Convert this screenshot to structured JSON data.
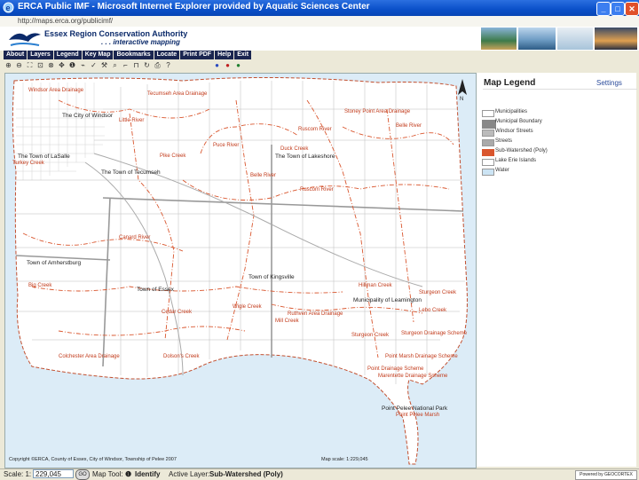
{
  "window": {
    "title": "ERCA Public IMF - Microsoft Internet Explorer provided by Aquatic Sciences Center",
    "address": "http://maps.erca.org/publicimf/"
  },
  "header": {
    "org_name": "Essex Region Conservation Authority",
    "tagline": ". . . interactive mapping"
  },
  "menu": [
    "About",
    "Layers",
    "Legend",
    "Key Map",
    "Bookmarks",
    "Locate",
    "Print PDF",
    "Help",
    "Exit"
  ],
  "map": {
    "copyright": "Copyright ©ERCA, County of Essex, City of Windsor, Township of Pelee 2007",
    "scale_readout": "Map scale: 1:229,045",
    "labels": {
      "windsor_drainage": "Windsor Area Drainage",
      "tecumseh_drainage": "Tecumseh Area Drainage",
      "city_windsor": "The City of Windsor",
      "little_river": "Little River",
      "stoney_point": "Stoney Point Area Drainage",
      "belle_river": "Belle River",
      "puce_river": "Puce River",
      "duck_creek": "Duck Creek",
      "ruscom": "Ruscom River",
      "lakeshore": "The Town of Lakeshore",
      "lasalle": "The Town of LaSalle",
      "turkey_creek": "Turkey Creek",
      "pike_creek": "Pike Creek",
      "tecumseh": "The Town of Tecumseh",
      "belle_river2": "Belle River",
      "canard": "Canard River",
      "amherstburg": "Town of Amherstburg",
      "big_creek": "Big Creek",
      "kingsville": "Town of Kingsville",
      "essex": "Town of Essex",
      "hillman": "Hillman Creek",
      "sturgeon": "Sturgeon Creek",
      "cedar_creek": "Cedar Creek",
      "leamington": "Municipality of Leamington",
      "wigle": "Wigle Creek",
      "mill_creek": "Mill Creek",
      "ruthven": "Ruthven Area Drainage",
      "lebo": "Lebo Creek",
      "colchester": "Colchester Area Drainage",
      "dolsons": "Dolson's Creek",
      "point_marsh": "Point Marsh Drainage Scheme",
      "point_drainage": "Point Drainage Scheme",
      "marentette": "Marentette Drainage Scheme",
      "point_pelee": "Point Pelee National Park",
      "point_pelee2": "Point Pelee Marsh",
      "sturgeon_drain": "Sturgeon Drainage Scheme"
    }
  },
  "legend": {
    "title": "Map Legend",
    "settings": "Settings",
    "items": [
      {
        "label": "Municipalities",
        "color": "#ffffff"
      },
      {
        "label": "Municipal Boundary",
        "color": "#888888"
      },
      {
        "label": "Windsor Streets",
        "color": "#bbbbbb"
      },
      {
        "label": "Streets",
        "color": "#aaaaaa"
      },
      {
        "label": "Sub-Watershed (Poly)",
        "color": "#d9562e"
      },
      {
        "label": "Lake Erie Islands",
        "color": "#ffffff"
      },
      {
        "label": "Water",
        "color": "#cce4f4"
      }
    ]
  },
  "status": {
    "scale_label": "Scale: 1:",
    "scale_value": "229,045",
    "go_label": "GO",
    "map_tool_label": "Map Tool:",
    "map_tool_value": "Identify",
    "active_layer_label": "Active Layer:",
    "active_layer_value": "Sub-Watershed (Poly)",
    "powered_by": "Powered by GEOCORTEX"
  },
  "colors": {
    "water": "#dcecf7",
    "land": "#ffffff",
    "watershed": "#d9562e",
    "menu_bg": "#1a2550"
  }
}
